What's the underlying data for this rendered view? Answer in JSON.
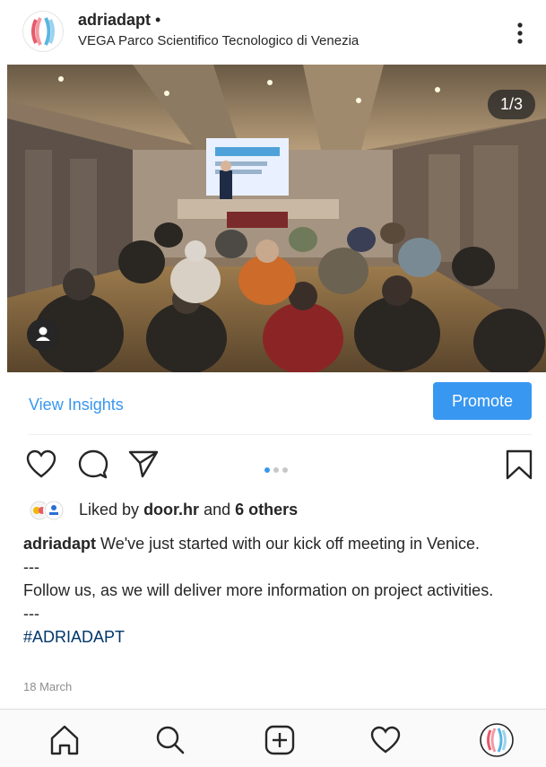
{
  "post": {
    "username": "adriadapt",
    "separator": "•",
    "location": "VEGA Parco Scientifico Tecnologico di Venezia",
    "carousel_counter": "1/3",
    "insights_label": "View Insights",
    "promote_label": "Promote",
    "likes": {
      "prefix": "Liked by",
      "first_user": "door.hr",
      "and": "and",
      "others": "6 others"
    },
    "caption": {
      "author": "adriadapt",
      "line1": "We've just started with our kick off meeting in Venice.",
      "sep1": "---",
      "line2": "Follow us, as we will deliver more information on project activities.",
      "sep2": "---",
      "hashtag": "#ADRIADAPT"
    },
    "date": "18 March"
  },
  "colors": {
    "accent": "#3897f0",
    "text": "#262626",
    "muted": "#8e8e8e",
    "hashtag": "#003569"
  },
  "icons": {
    "more": "more-vertical-icon",
    "like": "heart-icon",
    "comment": "comment-icon",
    "share": "paper-plane-icon",
    "save": "bookmark-icon",
    "nav": [
      "home-icon",
      "search-icon",
      "new-post-icon",
      "activity-heart-icon",
      "profile-avatar-icon"
    ]
  }
}
